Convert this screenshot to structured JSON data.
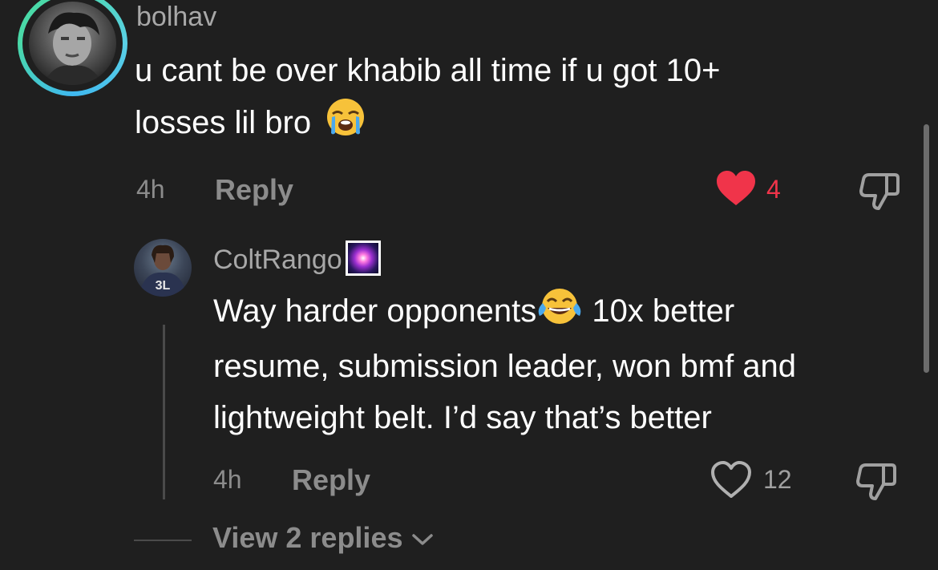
{
  "comment": {
    "username": "bolhav",
    "text_line1": "u cant be over khabib all time if u got 10+",
    "text_line2": "losses lil bro",
    "emoji": "loudly-crying-face",
    "time": "4h",
    "reply_label": "Reply",
    "likes": "4",
    "liked": true,
    "like_color": "#f0344a"
  },
  "reply": {
    "username": "ColtRango",
    "badge": "fireworks-emoji",
    "avatar_text": "3L",
    "text_line1_a": "Way harder opponents",
    "text_line1_b": " 10x better",
    "text_line2": "resume, submission leader, won bmf and",
    "text_line3": "lightweight belt. I’d say that’s better",
    "emoji": "face-with-tears-of-joy",
    "time": "4h",
    "reply_label": "Reply",
    "likes": "12",
    "liked": false
  },
  "view_replies": {
    "label": "View 2 replies"
  },
  "icons": {
    "dislike": "thumbs-down-icon",
    "like_filled": "heart-filled-icon",
    "like_outline": "heart-outline-icon",
    "chevron": "chevron-down-icon"
  }
}
